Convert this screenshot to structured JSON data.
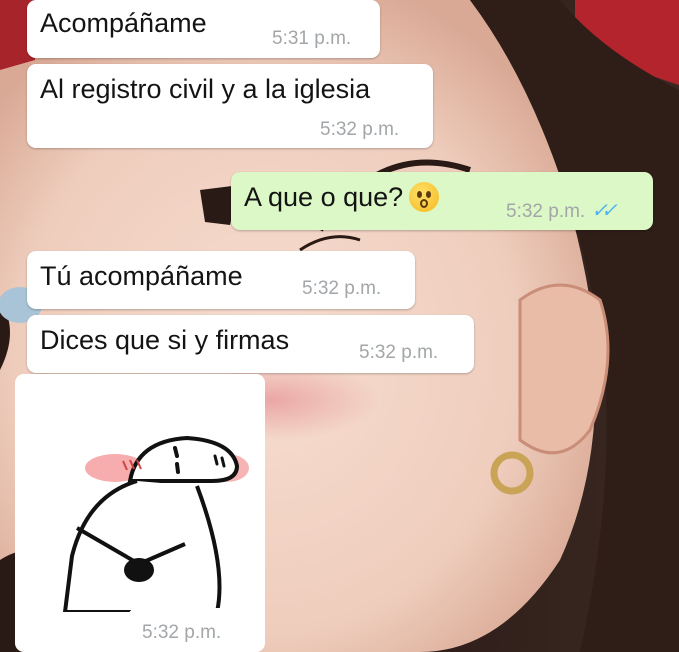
{
  "chat": {
    "messages": [
      {
        "direction": "incoming",
        "text": "Acompáñame",
        "time": "5:31 p.m."
      },
      {
        "direction": "incoming",
        "text": "Al registro civil y a la iglesia",
        "time": "5:32 p.m."
      },
      {
        "direction": "outgoing",
        "text": "A que o que?",
        "emoji": "hushed-face-emoji",
        "time": "5:32 p.m.",
        "status": "read-double-check-icon"
      },
      {
        "direction": "incoming",
        "text": "Tú acompáñame",
        "time": "5:32 p.m."
      },
      {
        "direction": "incoming",
        "text": "Dices que si y firmas",
        "time": "5:32 p.m."
      },
      {
        "direction": "incoming",
        "type": "sticker",
        "sticker": "flork-blushing-meme-sticker",
        "time": "5:32 p.m."
      }
    ]
  },
  "colors": {
    "incoming_bubble": "#ffffff",
    "outgoing_bubble": "#dcf8c6",
    "timestamp": "#a3a6a8",
    "read_ticks": "#4fb3f6"
  }
}
